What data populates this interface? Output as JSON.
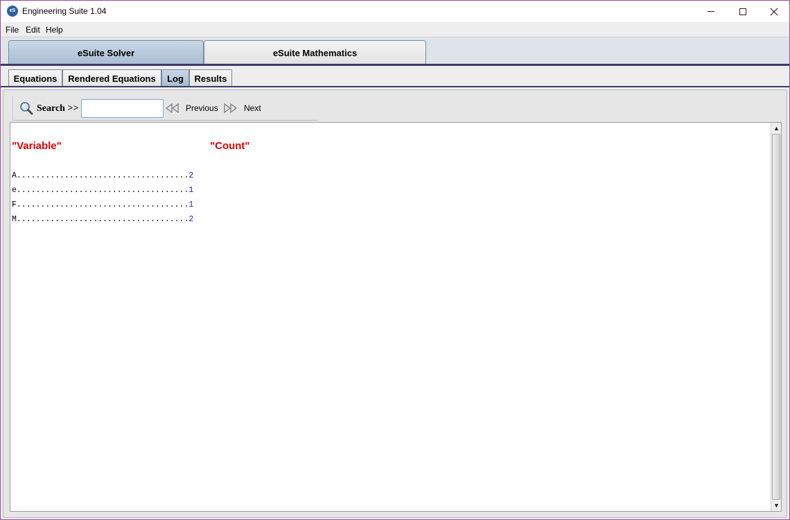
{
  "window": {
    "title": "Engineering Suite 1.04",
    "icon_text": "eS"
  },
  "menu": {
    "items": [
      "File",
      "Edit",
      "Help"
    ]
  },
  "main_tabs": [
    {
      "label": "eSuite Solver",
      "active": true
    },
    {
      "label": "eSuite Mathematics",
      "active": false
    }
  ],
  "sub_tabs": [
    {
      "label": "Equations",
      "active": false
    },
    {
      "label": "Rendered Equations",
      "active": false
    },
    {
      "label": "Log",
      "active": true
    },
    {
      "label": "Results",
      "active": false
    }
  ],
  "toolbar": {
    "search_label": "Search >>",
    "search_value": "",
    "previous_label": "Previous",
    "next_label": "Next"
  },
  "log": {
    "header_variable": "\"Variable\"",
    "header_count": "\"Count\"",
    "rows": [
      {
        "variable": "A",
        "dots": "....................................",
        "count": "2"
      },
      {
        "variable": "e",
        "dots": "....................................",
        "count": "1"
      },
      {
        "variable": "F",
        "dots": "....................................",
        "count": "1"
      },
      {
        "variable": "M",
        "dots": "....................................",
        "count": "2"
      }
    ]
  },
  "colors": {
    "header_red": "#e00000",
    "count_blue": "#1a1acc",
    "active_tab": "#b3c5d9",
    "tab_divider": "#3a3a6a"
  },
  "icons": {
    "search": "magnifier-icon",
    "previous": "double-chevron-left-icon",
    "next": "double-chevron-right-icon",
    "scroll_up": "triangle-up-icon",
    "scroll_down": "triangle-down-icon"
  }
}
